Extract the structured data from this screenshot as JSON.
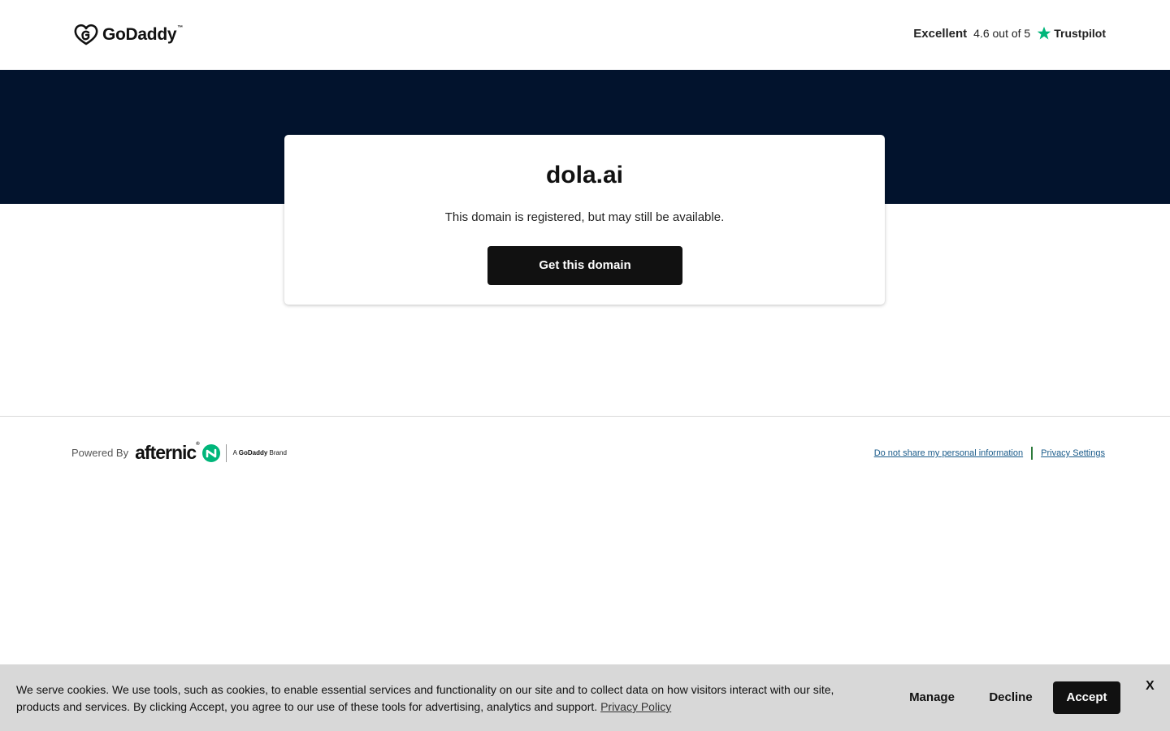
{
  "header": {
    "logo_text": "GoDaddy",
    "logo_tm": "™",
    "trust_rating_word": "Excellent",
    "trust_score": "4.6 out of 5",
    "trust_brand": "Trustpilot",
    "trust_star_color": "#00b67a"
  },
  "hero": {
    "background_color": "#02132d"
  },
  "card": {
    "domain": "dola.ai",
    "message": "This domain is registered, but may still be available.",
    "cta_label": "Get this domain"
  },
  "footer": {
    "powered_by_label": "Powered By",
    "brand_name": "afternic",
    "brand_tm": "®",
    "brand_tag_a": "A",
    "brand_tag_name": "GoDaddy",
    "brand_tag_suffix": "Brand",
    "brand_accent_color": "#00b67a",
    "links": [
      {
        "label": "Do not share my personal information"
      },
      {
        "label": "Privacy Settings"
      }
    ]
  },
  "cookie_banner": {
    "text": "We serve cookies. We use tools, such as cookies, to enable essential services and functionality on our site and to collect data on how visitors interact with our site, products and services. By clicking Accept, you agree to our use of these tools for advertising, analytics and support.",
    "policy_link": "Privacy Policy",
    "manage_label": "Manage",
    "decline_label": "Decline",
    "accept_label": "Accept",
    "close_label": "X"
  }
}
